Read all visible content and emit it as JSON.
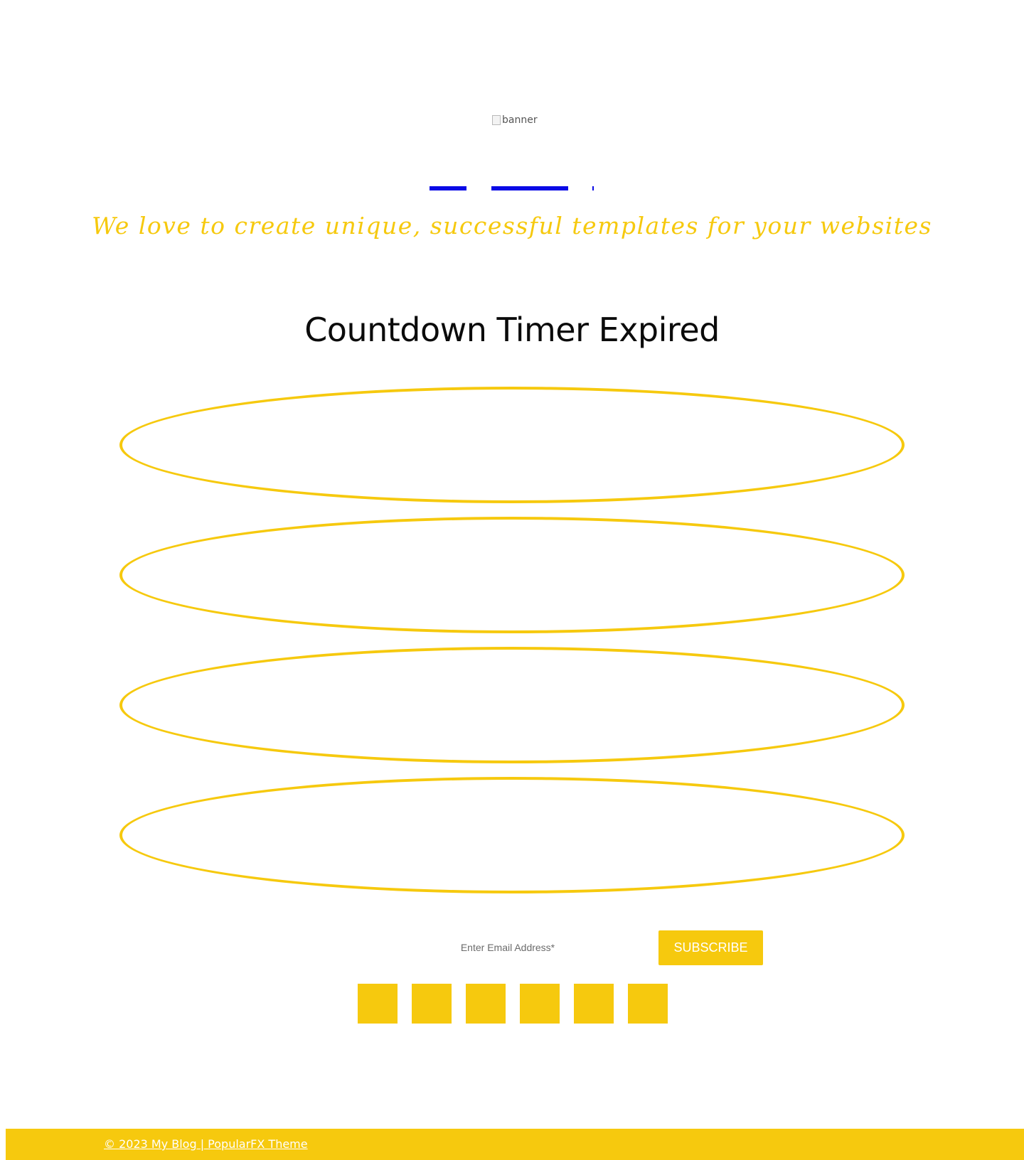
{
  "banner": {
    "alt_text": "banner"
  },
  "nav": {
    "items": [
      {
        "label": ""
      },
      {
        "label": ""
      },
      {
        "label": ""
      }
    ]
  },
  "tagline": "We love to create unique, successful templates for your websites",
  "countdown": {
    "title": "Countdown Timer Expired"
  },
  "subscribe": {
    "email_placeholder": "Enter Email Address*",
    "button_label": "SUBSCRIBE"
  },
  "social": {
    "icons": [
      "social-icon-1",
      "social-icon-2",
      "social-icon-3",
      "social-icon-4",
      "social-icon-5",
      "social-icon-6"
    ]
  },
  "footer": {
    "copyright": "© 2023 My Blog | PopularFX Theme"
  },
  "colors": {
    "accent": "#f6c90e",
    "link_blue": "#0a0ae6",
    "text_dark": "#0b0b0b",
    "background": "#ffffff"
  }
}
